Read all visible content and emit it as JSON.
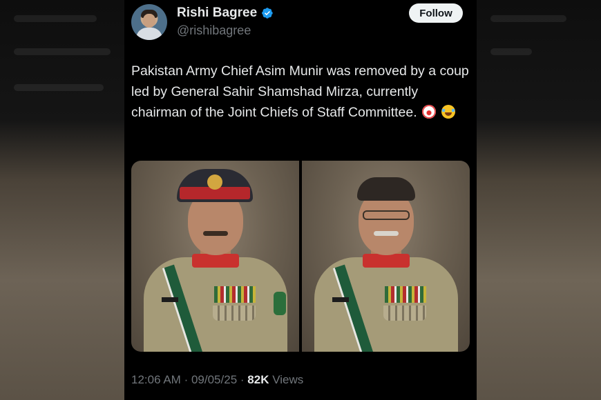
{
  "author": {
    "display_name": "Rishi Bagree",
    "handle": "@rishibagree",
    "verified": true
  },
  "follow_label": "Follow",
  "tweet": {
    "text": "Pakistan Army Chief Asim Munir was removed by a coup led by General Sahir Shamshad Mirza, currently chairman of the Joint Chiefs of Staff Committee.",
    "emojis": [
      "clown-face",
      "face-with-tears-of-joy"
    ]
  },
  "media": {
    "photos": [
      "general-portrait-with-peaked-cap",
      "general-portrait-with-glasses"
    ]
  },
  "meta": {
    "time": "12:06 AM",
    "separator": "·",
    "date": "09/05/25",
    "views_count": "82K",
    "views_label": "Views"
  },
  "colors": {
    "background": "#000000",
    "text_primary": "#e7e9ea",
    "text_secondary": "#71767b",
    "verified": "#1d9bf0",
    "follow_bg": "#eff3f4"
  }
}
